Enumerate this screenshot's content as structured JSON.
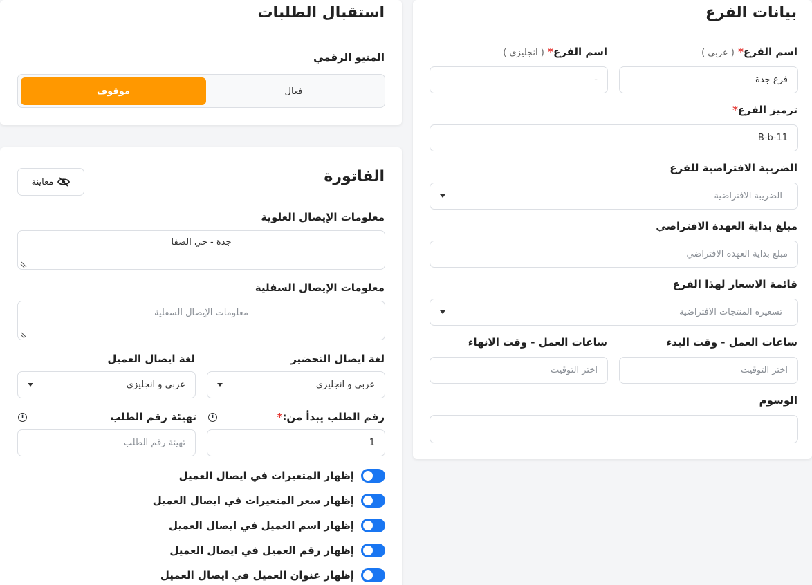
{
  "branch": {
    "title": "بيانات الفرع",
    "name_ar": {
      "label": "اسم الفرع",
      "req": "*",
      "hint": "( عربي )",
      "value": "فرع جدة"
    },
    "name_en": {
      "label": "اسم الفرع",
      "req": "*",
      "hint": "( انجليزي )",
      "value": "-"
    },
    "code": {
      "label": "ترميز الفرع",
      "req": "*",
      "value": "B-b-11"
    },
    "tax": {
      "label": "الضريبة الافتراضية للفرع",
      "placeholder": "الضريبة الافتراضية"
    },
    "custody": {
      "label": "مبلغ بداية العهدة الافتراضي",
      "placeholder": "مبلغ بداية العهدة الافتراضي"
    },
    "pricelist": {
      "label": "قائمة الاسعار لهذا الفرع",
      "placeholder": "تسعيرة المنتجات الافتراضية"
    },
    "start_time": {
      "label": "ساعات العمل - وقت البدء",
      "placeholder": "اختر التوقيت"
    },
    "end_time": {
      "label": "ساعات العمل - وقت الانهاء",
      "placeholder": "اختر التوقيت"
    },
    "tags": {
      "label": "الوسوم",
      "value": ""
    }
  },
  "orders": {
    "title": "استقبال الطلبات",
    "menu_label": "المنيو الرقمي",
    "option_active": "فعال",
    "option_stopped": "موقوف"
  },
  "invoice": {
    "title": "الفاتورة",
    "preview_label": "معاينة",
    "header_info": {
      "label": "معلومات الإيصال العلوية",
      "value": "جدة - حي الصفا"
    },
    "footer_info": {
      "label": "معلومات الإيصال السفلية",
      "placeholder": "معلومات الإيصال السفلية"
    },
    "prep_lang": {
      "label": "لغة ايصال التحضير",
      "value": "عربي و انجليزي"
    },
    "customer_lang": {
      "label": "لغة ايصال العميل",
      "value": "عربي و انجليزي"
    },
    "order_start": {
      "label": "رقم الطلب يبدأ من:",
      "req": "*",
      "value": "1"
    },
    "order_reset": {
      "label": "تهيئة رقم الطلب",
      "placeholder": "تهيئة رقم الطلب"
    },
    "toggles": [
      "إظهار المتغيرات في ايصال العميل",
      "إظهار سعر المتغيرات في ايصال العميل",
      "إظهار اسم العميل في ايصال العميل",
      "إظهار رقم العميل في ايصال العميل",
      "إظهار عنوان العميل في ايصال العميل"
    ]
  }
}
